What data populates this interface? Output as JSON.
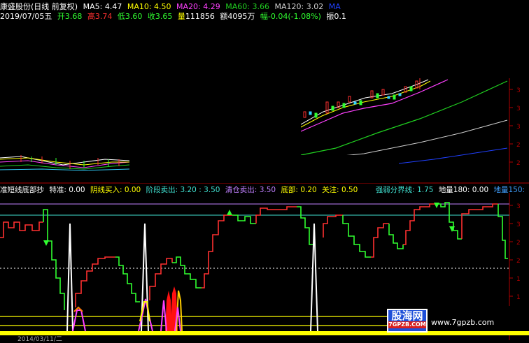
{
  "header": {
    "stock_title": "康盛股份(日线 前复权)",
    "ma5_label": "MA5:",
    "ma5": "4.47",
    "ma10_label": "MA10:",
    "ma10": "4.50",
    "ma20_label": "MA20:",
    "ma20": "4.29",
    "ma60_label": "MA60:",
    "ma60": "3.66",
    "ma120_label": "MA120:",
    "ma120": "3.02",
    "ma_more": "MA"
  },
  "quote": {
    "date": "2019/07/05五",
    "open_label": "开",
    "open": "3.68",
    "high_label": "高",
    "high": "3.74",
    "low_label": "低",
    "low": "3.60",
    "close_label": "收",
    "close": "3.65",
    "volume_label": "量",
    "volume": "111856",
    "amount_label": "额",
    "amount": "4095万",
    "change_label": "幅",
    "change": "-0.04(-1.08%)",
    "amplitude_label": "振",
    "amplitude": "0.1"
  },
  "indicator": {
    "name": "准短线底部抄",
    "teting_label": "特准:",
    "teting": "0.00",
    "yinxian_label": "阴线买入:",
    "yinxian": "0.00",
    "jieduan_label": "阶段卖出:",
    "jieduan": "3.20 : 3.50",
    "qingcang_label": "清仓卖出:",
    "qingcang": "3.50",
    "dibu_label": "底部:",
    "dibu": "0.20",
    "guanzhu_label": "关注:",
    "guanzhu": "0.50",
    "qiangruo_label": "强弱分界线:",
    "qiangruo": "1.75",
    "diliang180_label": "地量180:",
    "diliang180": "0.00",
    "diliang150_label": "地量150:"
  },
  "watermark": {
    "logo_text": "股海网",
    "logo_sub": "7GPZB.COM",
    "url": "www.7gpzb.com"
  },
  "bottom_date": "2014/03/11/二",
  "colors": {
    "up": "#ff3030",
    "down": "#30ff30",
    "white": "#ffffff",
    "yellow": "#ffff00",
    "magenta": "#ff40ff",
    "green": "#20d020",
    "grey": "#cfcfcf",
    "blue": "#2040ff",
    "axis": "#b00000"
  }
}
